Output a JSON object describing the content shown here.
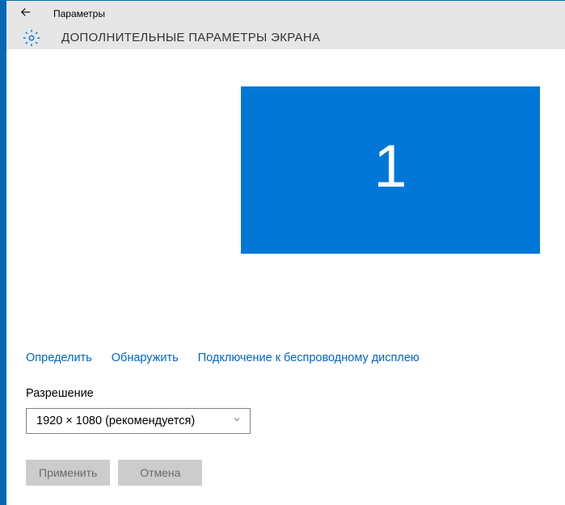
{
  "titlebar": {
    "app_name": "Параметры"
  },
  "header": {
    "title": "ДОПОЛНИТЕЛЬНЫЕ ПАРАМЕТРЫ ЭКРАНА"
  },
  "display": {
    "monitor_number": "1"
  },
  "links": {
    "identify": "Определить",
    "detect": "Обнаружить",
    "wireless": "Подключение к беспроводному дисплею"
  },
  "resolution": {
    "label": "Разрешение",
    "selected": "1920 × 1080 (рекомендуется)"
  },
  "buttons": {
    "apply": "Применить",
    "cancel": "Отмена"
  }
}
